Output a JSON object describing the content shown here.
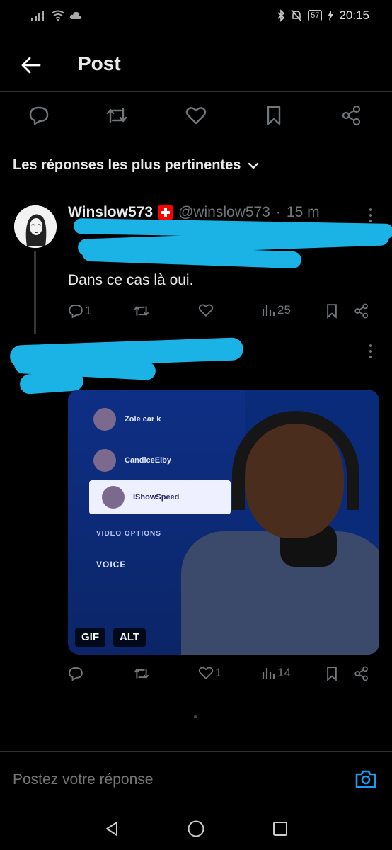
{
  "status_bar": {
    "time": "20:15",
    "battery": "57"
  },
  "header": {
    "title": "Post"
  },
  "sort": {
    "label": "Les réponses les plus pertinentes"
  },
  "reply1": {
    "author": "Winslow573",
    "handle": "@winslow573",
    "separator": "·",
    "age": "15 m",
    "text": "Dans ce cas là oui.",
    "replies": "1",
    "views": "25"
  },
  "reply2": {
    "media_tags": [
      "GIF",
      "ALT"
    ],
    "likes": "1",
    "views": "14",
    "media_text": {
      "row1": "Zole car k",
      "row2": "CandiceElby",
      "row3": "IShowSpeed",
      "label1": "VIDEO OPTIONS",
      "label2": "VOICE"
    }
  },
  "composer": {
    "placeholder": "Postez votre réponse"
  },
  "colors": {
    "accent": "#1d9bf0",
    "redaction": "#1bb3e6",
    "background": "#000000",
    "muted": "#71767b"
  }
}
